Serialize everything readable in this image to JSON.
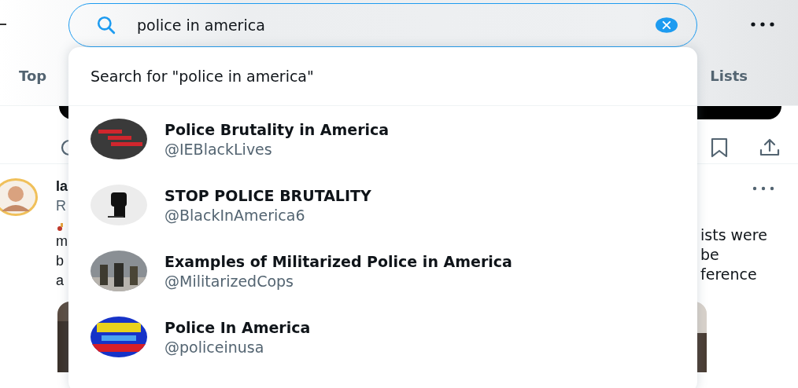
{
  "search": {
    "value": "police in america"
  },
  "tabs": [
    {
      "label": "Top",
      "selected": false
    },
    {
      "label": "Lists",
      "selected": false
    }
  ],
  "dropdown": {
    "search_for": "Search for \"police in america\"",
    "accounts": [
      {
        "name": "Police Brutality in America",
        "handle": "@IEBlackLives"
      },
      {
        "name": "STOP POLICE BRUTALITY",
        "handle": "@BlackInAmerica6"
      },
      {
        "name": "Examples of Militarized Police in America",
        "handle": "@MilitarizedCops"
      },
      {
        "name": "Police In America",
        "handle": "@policeinusa"
      }
    ]
  },
  "tweet": {
    "author": "la",
    "handle": "R",
    "left_lines": [
      "m",
      "b",
      "a"
    ],
    "right_lines": [
      "ists were",
      "be",
      "ference"
    ]
  }
}
